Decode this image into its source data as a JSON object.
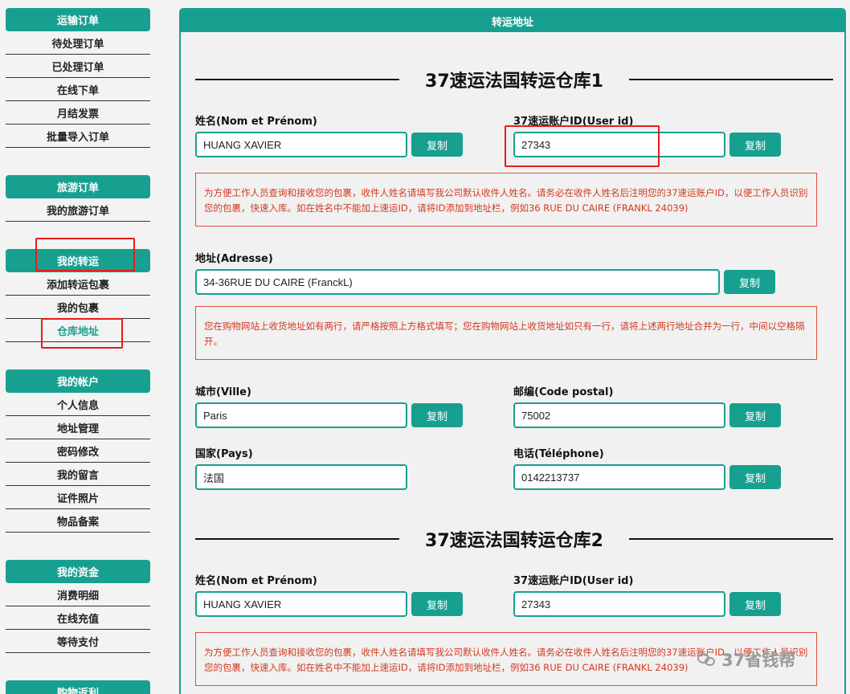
{
  "sidebar": {
    "sections": [
      {
        "title": "运输订单",
        "items": [
          "待处理订单",
          "已处理订单",
          "在线下单",
          "月结发票",
          "批量导入订单"
        ]
      },
      {
        "title": "旅游订单",
        "items": [
          "我的旅游订单"
        ]
      },
      {
        "title": "我的转运",
        "items": [
          "添加转运包裹",
          "我的包裹",
          "仓库地址"
        ]
      },
      {
        "title": "我的帐户",
        "items": [
          "个人信息",
          "地址管理",
          "密码修改",
          "我的留言",
          "证件照片",
          "物品备案"
        ]
      },
      {
        "title": "我的资金",
        "items": [
          "消费明细",
          "在线充值",
          "等待支付"
        ]
      },
      {
        "title": "购物返利",
        "items": []
      }
    ],
    "active_item": "仓库地址"
  },
  "main": {
    "header": "转运地址",
    "copy_label": "复制",
    "warehouse1": {
      "title": "37速运法国转运仓库1",
      "name_label": "姓名(Nom et Prénom)",
      "name_value": "HUANG XAVIER",
      "userid_label": "37速运账户ID(User id)",
      "userid_value": "27343",
      "notice1": "为方便工作人员查询和接收您的包裹，收件人姓名请填写我公司默认收件人姓名。请务必在收件人姓名后注明您的37速运账户ID，以便工作人员识别您的包裹，快速入库。如在姓名中不能加上速运ID，请将ID添加到地址栏，例如36 RUE DU CAIRE (FRANKL 24039)",
      "address_label": "地址(Adresse)",
      "address_value": "34-36RUE DU CAIRE (FranckL)",
      "notice2": "您在购物网站上收货地址如有两行，请严格按照上方格式填写；您在购物网站上收货地址如只有一行，请将上述两行地址合并为一行，中间以空格隔开。",
      "city_label": "城市(Ville)",
      "city_value": "Paris",
      "postal_label": "邮编(Code postal)",
      "postal_value": "75002",
      "country_label": "国家(Pays)",
      "country_value": "法国",
      "phone_label": "电话(Téléphone)",
      "phone_value": "0142213737"
    },
    "warehouse2": {
      "title": "37速运法国转运仓库2",
      "name_label": "姓名(Nom et Prénom)",
      "name_value": "HUANG XAVIER",
      "userid_label": "37速运账户ID(User id)",
      "userid_value": "27343",
      "notice1": "为方便工作人员查询和接收您的包裹，收件人姓名请填写我公司默认收件人姓名。请务必在收件人姓名后注明您的37速运账户ID，以便工作人员识别您的包裹，快速入库。如在姓名中不能加上速运ID，请将ID添加到地址栏，例如36 RUE DU CAIRE (FRANKL 24039)"
    }
  },
  "watermark": "37省钱帮",
  "colors": {
    "accent": "#17a090",
    "notice_red": "#d23a1e",
    "highlight_red": "#e81c1c"
  }
}
